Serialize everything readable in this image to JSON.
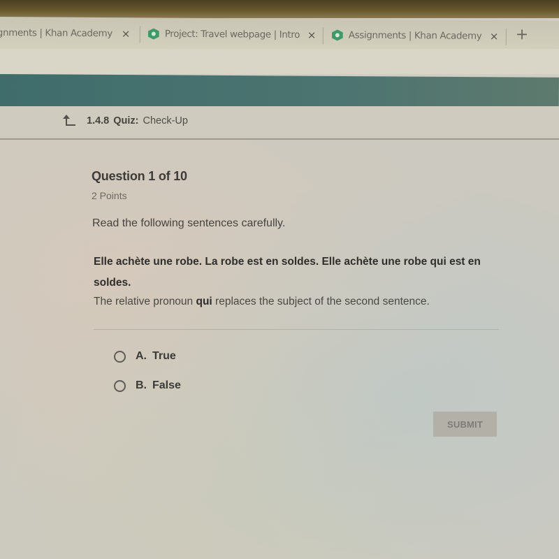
{
  "browser": {
    "tabs": [
      {
        "title": "gnments | Khan Academy",
        "active": false,
        "has_favicon": false
      },
      {
        "title": "Project: Travel webpage | Intro to",
        "active": false,
        "has_favicon": true
      },
      {
        "title": "Assignments | Khan Academy",
        "active": false,
        "has_favicon": true
      }
    ],
    "close_glyph": "×",
    "new_tab_glyph": "+",
    "favicon_icon": "khan-academy-icon"
  },
  "header": {
    "brand_color": "#45706d"
  },
  "breadcrumb": {
    "back_icon": "up-arrow-icon",
    "number": "1.4.8",
    "type": "Quiz:",
    "title": "Check-Up"
  },
  "question": {
    "heading": "Question 1 of 10",
    "points": "2 Points",
    "instruction": "Read the following sentences carefully.",
    "sentences": "Elle achète une robe. La robe est en soldes. Elle achète une robe qui est en soldes.",
    "statement_before": "The relative pronoun ",
    "statement_bold": "qui",
    "statement_after": " replaces the subject of the second sentence.",
    "options": [
      {
        "letter": "A.",
        "text": "True",
        "selected": false
      },
      {
        "letter": "B.",
        "text": "False",
        "selected": false
      }
    ]
  },
  "actions": {
    "submit_label": "SUBMIT",
    "submit_enabled": false
  }
}
